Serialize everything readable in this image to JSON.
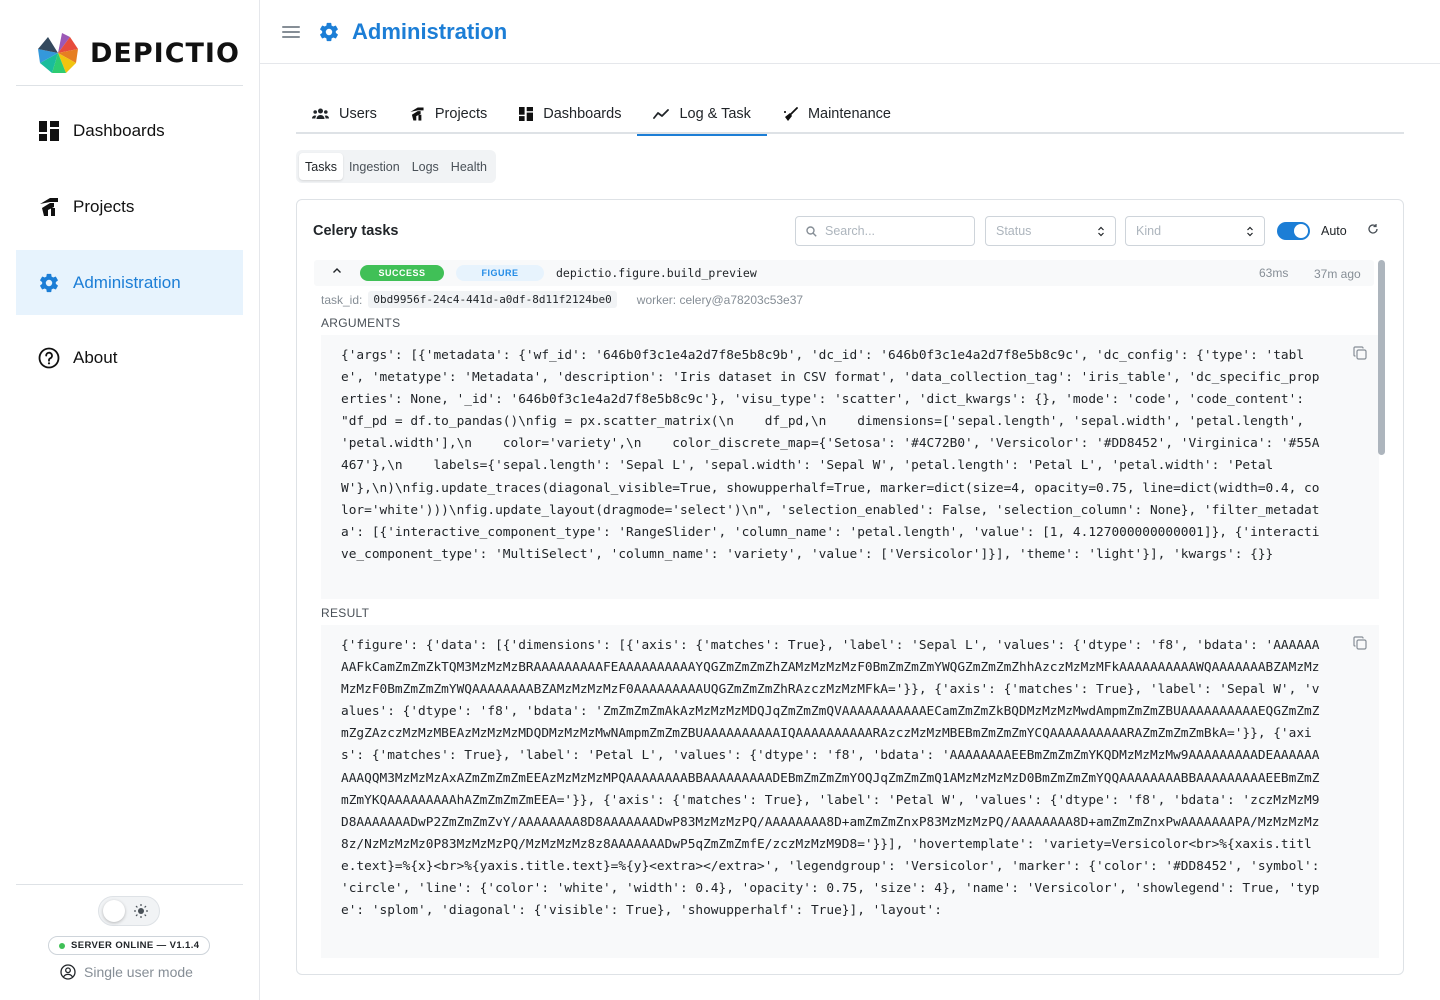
{
  "app": {
    "name": "DEPICTIO"
  },
  "sidebar": {
    "items": [
      {
        "label": "Dashboards",
        "icon": "dashboard-icon"
      },
      {
        "label": "Projects",
        "icon": "projects-icon"
      },
      {
        "label": "Administration",
        "icon": "gear-icon",
        "active": true
      },
      {
        "label": "About",
        "icon": "help-circle-icon"
      }
    ],
    "server_status": "SERVER ONLINE — V1.1.4",
    "mode": "Single user mode"
  },
  "header": {
    "title": "Administration"
  },
  "tabs": [
    {
      "label": "Users",
      "icon": "users-icon"
    },
    {
      "label": "Projects",
      "icon": "projects-icon"
    },
    {
      "label": "Dashboards",
      "icon": "dashboard-icon"
    },
    {
      "label": "Log & Task",
      "icon": "chart-line-icon",
      "active": true
    },
    {
      "label": "Maintenance",
      "icon": "broom-icon"
    }
  ],
  "subtabs": [
    {
      "label": "Tasks",
      "active": true
    },
    {
      "label": "Ingestion"
    },
    {
      "label": "Logs"
    },
    {
      "label": "Health"
    }
  ],
  "tasks_panel": {
    "title": "Celery tasks",
    "search_placeholder": "Search...",
    "status_placeholder": "Status",
    "kind_placeholder": "Kind",
    "auto_label": "Auto",
    "auto_enabled": true
  },
  "task": {
    "status": "SUCCESS",
    "kind": "FIGURE",
    "name": "depictio.figure.build_preview",
    "duration": "63ms",
    "age": "37m ago",
    "task_id_label": "task_id:",
    "task_id": "0bd9956f-24c4-441d-a0df-8d11f2124be0",
    "worker": "worker: celery@a78203c53e37",
    "arguments_label": "ARGUMENTS",
    "result_label": "RESULT",
    "arguments": "{'args': [{'metadata': {'wf_id': '646b0f3c1e4a2d7f8e5b8c9b', 'dc_id': '646b0f3c1e4a2d7f8e5b8c9c', 'dc_config': {'type': 'table', 'metatype': 'Metadata', 'description': 'Iris dataset in CSV format', 'data_collection_tag': 'iris_table', 'dc_specific_properties': None, '_id': '646b0f3c1e4a2d7f8e5b8c9c'}, 'visu_type': 'scatter', 'dict_kwargs': {}, 'mode': 'code', 'code_content': \"df_pd = df.to_pandas()\\nfig = px.scatter_matrix(\\n    df_pd,\\n    dimensions=['sepal.length', 'sepal.width', 'petal.length', 'petal.width'],\\n    color='variety',\\n    color_discrete_map={'Setosa': '#4C72B0', 'Versicolor': '#DD8452', 'Virginica': '#55A467'},\\n    labels={'sepal.length': 'Sepal L', 'sepal.width': 'Sepal W', 'petal.length': 'Petal L', 'petal.width': 'Petal W'},\\n)\\nfig.update_traces(diagonal_visible=True, showupperhalf=True, marker=dict(size=4, opacity=0.75, line=dict(width=0.4, color='white')))\\nfig.update_layout(dragmode='select')\\n\", 'selection_enabled': False, 'selection_column': None}, 'filter_metadata': [{'interactive_component_type': 'RangeSlider', 'column_name': 'petal.length', 'value': [1, 4.127000000000001]}, {'interactive_component_type': 'MultiSelect', 'column_name': 'variety', 'value': ['Versicolor']}], 'theme': 'light'}], 'kwargs': {}}",
    "result": "{'figure': {'data': [{'dimensions': [{'axis': {'matches': True}, 'label': 'Sepal L', 'values': {'dtype': 'f8', 'bdata': 'AAAAAAAAFkCamZmZmZkTQM3MzMzMzBRAAAAAAAAAFEAAAAAAAAAAYQGZmZmZmZhZAMzMzMzMzF0BmZmZmZmYWQGZmZmZmZhhAzczMzMzMFkAAAAAAAAAAWQAAAAAAABZAMzMzMzMzF0BmZmZmZmYWQAAAAAAAABZAMzMzMzMzF0AAAAAAAAAUQGZmZmZmZhRAzczMzMzMFkA='}}, {'axis': {'matches': True}, 'label': 'Sepal W', 'values': {'dtype': 'f8', 'bdata': 'ZmZmZmZmAkAzMzMzMzMDQJqZmZmZmQVAAAAAAAAAAAECamZmZmZkBQDMzMzMzMwdAmpmZmZmZBUAAAAAAAAAAEQGZmZmZmZgZAzczMzMzMBEAzMzMzMzMDQDMzMzMzMwNAmpmZmZmZBUAAAAAAAAAAIQAAAAAAAAAARAzczMzMzMBEBmZmZmZmYCQAAAAAAAAAARAZmZmZmZmBkA='}}, {'axis': {'matches': True}, 'label': 'Petal L', 'values': {'dtype': 'f8', 'bdata': 'AAAAAAAAEEBmZmZmZmYKQDMzMzMzMw9AAAAAAAAADEAAAAAAAAAQQM3MzMzMzAxAZmZmZmZmEEAzMzMzMzMPQAAAAAAAABBAAAAAAAAADEBmZmZmZmYOQJqZmZmZmQ1AMzMzMzMzD0BmZmZmZmYQQAAAAAAAABBAAAAAAAAAEEBmZmZmZmYKQAAAAAAAAAhAZmZmZmZmEEA='}}, {'axis': {'matches': True}, 'label': 'Petal W', 'values': {'dtype': 'f8', 'bdata': 'zczMzMzM9D8AAAAAAADwP2ZmZmZmZvY/AAAAAAAA8D8AAAAAAADwP83MzMzMzPQ/AAAAAAAA8D+amZmZmZnxP83MzMzMzPQ/AAAAAAAA8D+amZmZmZnxPwAAAAAAAPA/MzMzMzMz8z/NzMzMzMz0P83MzMzMzPQ/MzMzMzMz8z8AAAAAAADwP5qZmZmZmfE/zczMzMzM9D8='}}], 'hovertemplate': 'variety=Versicolor<br>%{xaxis.title.text}=%{x}<br>%{yaxis.title.text}=%{y}<extra></extra>', 'legendgroup': 'Versicolor', 'marker': {'color': '#DD8452', 'symbol': 'circle', 'line': {'color': 'white', 'width': 0.4}, 'opacity': 0.75, 'size': 4}, 'name': 'Versicolor', 'showlegend': True, 'type': 'splom', 'diagonal': {'visible': True}, 'showupperhalf': True}], 'layout':"
  },
  "colors": {
    "accent": "#1c7ed6",
    "success": "#40c057",
    "active_bg": "#e7f3fd"
  }
}
